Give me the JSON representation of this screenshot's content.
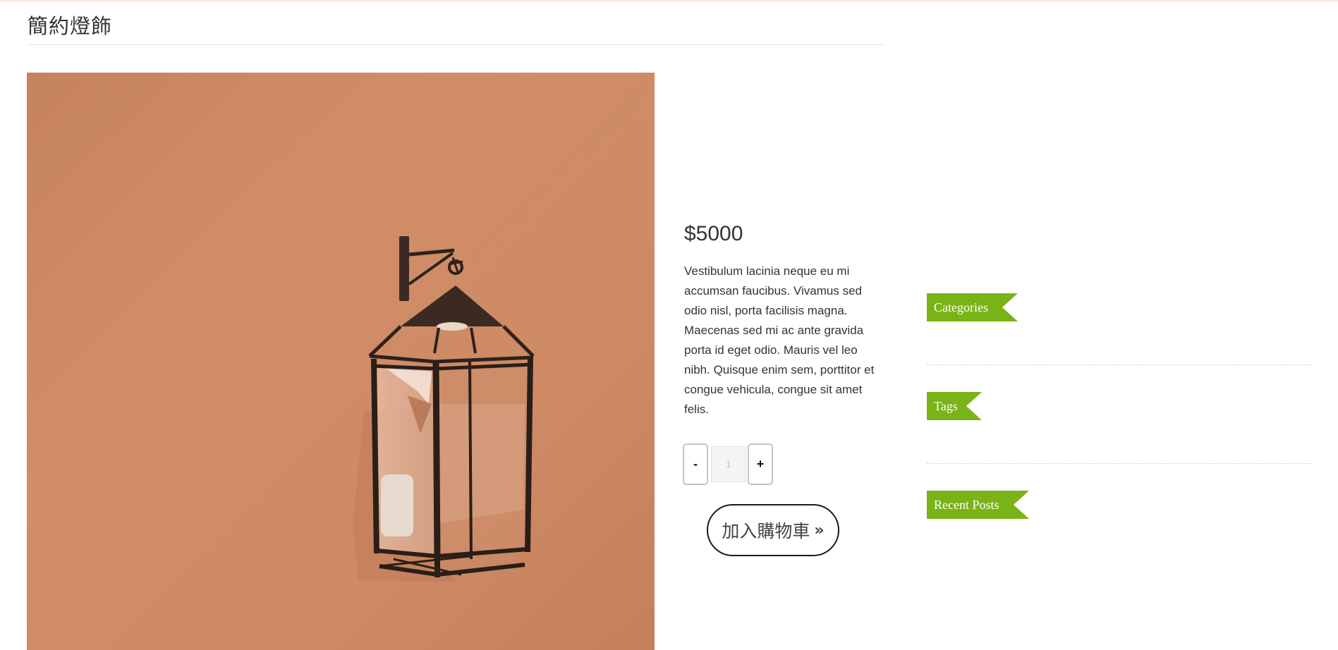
{
  "page": {
    "title": "簡約燈飾"
  },
  "product": {
    "image_alt": "lantern-on-terracotta-wall",
    "price": "$5000",
    "description": "Vestibulum lacinia neque eu mi accumsan faucibus. Vivamus sed odio nisl, porta facilisis magna. Maecenas sed mi ac ante gravida porta id eget odio. Mauris vel leo nibh. Quisque enim sem, porttitor et congue vehicula, congue sit amet felis.",
    "quantity": {
      "minus_label": "-",
      "plus_label": "+",
      "value": "1"
    },
    "add_to_cart_label": "加入購物車",
    "add_to_cart_arrow": "»"
  },
  "sidebar": {
    "widgets": [
      {
        "title": "Categories"
      },
      {
        "title": "Tags"
      },
      {
        "title": "Recent Posts"
      }
    ]
  },
  "colors": {
    "accent_green": "#7ab317",
    "wall": "#cd8a65",
    "text": "#333333"
  }
}
